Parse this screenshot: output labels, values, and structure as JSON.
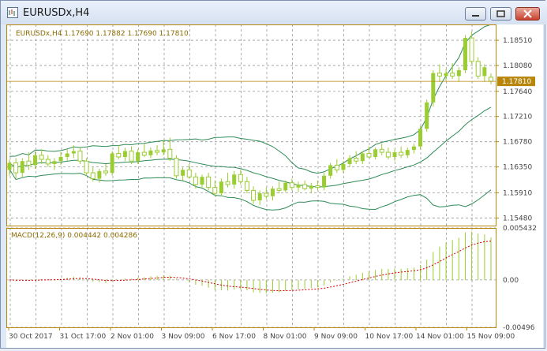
{
  "window": {
    "title": "EURUSDx,H4"
  },
  "colors": {
    "background": "#ffffff",
    "frame": "#b8860b",
    "grid": "#9a9a9a",
    "candle_bull": "#9acd32",
    "candle_bear": "#9acd32",
    "bands": "#2e8b57",
    "macd_hist": "#9acd32",
    "macd_signal": "#cc0000",
    "price_tag_bg": "#b8860b",
    "axis_text": "#b8860b"
  },
  "chart_data": [
    {
      "type": "candlestick",
      "symbol": "EURUSDx",
      "timeframe": "H4",
      "legend": "EURUSDx,H4  1.17690 1.17882 1.17690 1.17810",
      "ohlc_label": {
        "open": 1.1769,
        "high": 1.17882,
        "low": 1.1769,
        "close": 1.1781
      },
      "current_price": "1.17810",
      "y_ticks": [
        "1.18510",
        "1.18080",
        "1.17640",
        "1.17210",
        "1.16780",
        "1.16350",
        "1.15910",
        "1.15480"
      ],
      "ylim": [
        1.1535,
        1.1878
      ],
      "candles": [
        [
          1.163,
          1.1648,
          1.162,
          1.1642
        ],
        [
          1.1642,
          1.165,
          1.1615,
          1.1625
        ],
        [
          1.1625,
          1.165,
          1.1618,
          1.1645
        ],
        [
          1.1645,
          1.166,
          1.163,
          1.1638
        ],
        [
          1.1638,
          1.1662,
          1.1632,
          1.1655
        ],
        [
          1.1655,
          1.1665,
          1.164,
          1.1648
        ],
        [
          1.1648,
          1.1655,
          1.1635,
          1.164
        ],
        [
          1.164,
          1.165,
          1.163,
          1.1645
        ],
        [
          1.1645,
          1.166,
          1.1638,
          1.1652
        ],
        [
          1.1652,
          1.1665,
          1.1645,
          1.1658
        ],
        [
          1.1658,
          1.1672,
          1.165,
          1.1662
        ],
        [
          1.1662,
          1.1668,
          1.164,
          1.1645
        ],
        [
          1.1645,
          1.165,
          1.162,
          1.1625
        ],
        [
          1.1625,
          1.1635,
          1.161,
          1.1615
        ],
        [
          1.1615,
          1.1632,
          1.1608,
          1.1628
        ],
        [
          1.1628,
          1.164,
          1.162,
          1.1625
        ],
        [
          1.1625,
          1.1662,
          1.162,
          1.1658
        ],
        [
          1.1658,
          1.1672,
          1.1648,
          1.1652
        ],
        [
          1.1652,
          1.1668,
          1.1645,
          1.1662
        ],
        [
          1.1662,
          1.167,
          1.164,
          1.1645
        ],
        [
          1.1645,
          1.1665,
          1.164,
          1.166
        ],
        [
          1.166,
          1.1675,
          1.1652,
          1.1655
        ],
        [
          1.1655,
          1.1668,
          1.165,
          1.1663
        ],
        [
          1.1663,
          1.1672,
          1.1655,
          1.166
        ],
        [
          1.166,
          1.168,
          1.1655,
          1.1665
        ],
        [
          1.1665,
          1.1685,
          1.1645,
          1.165
        ],
        [
          1.165,
          1.1655,
          1.1615,
          1.162
        ],
        [
          1.162,
          1.1635,
          1.1612,
          1.163
        ],
        [
          1.163,
          1.164,
          1.1615,
          1.1618
        ],
        [
          1.1618,
          1.1625,
          1.1598,
          1.1605
        ],
        [
          1.1605,
          1.1622,
          1.16,
          1.1618
        ],
        [
          1.1618,
          1.1625,
          1.1595,
          1.16
        ],
        [
          1.16,
          1.1612,
          1.1585,
          1.159
        ],
        [
          1.159,
          1.1615,
          1.1585,
          1.161
        ],
        [
          1.161,
          1.1625,
          1.16,
          1.1605
        ],
        [
          1.1605,
          1.1628,
          1.1598,
          1.1622
        ],
        [
          1.1622,
          1.163,
          1.1605,
          1.161
        ],
        [
          1.161,
          1.1618,
          1.159,
          1.1595
        ],
        [
          1.1595,
          1.1602,
          1.1572,
          1.1578
        ],
        [
          1.1578,
          1.1595,
          1.157,
          1.159
        ],
        [
          1.159,
          1.16,
          1.158,
          1.1585
        ],
        [
          1.1585,
          1.1602,
          1.1578,
          1.1598
        ],
        [
          1.1598,
          1.161,
          1.159,
          1.1595
        ],
        [
          1.1595,
          1.1612,
          1.1592,
          1.1608
        ],
        [
          1.1608,
          1.1615,
          1.1595,
          1.16
        ],
        [
          1.16,
          1.161,
          1.1592,
          1.1605
        ],
        [
          1.1605,
          1.1612,
          1.1595,
          1.1598
        ],
        [
          1.1598,
          1.1608,
          1.159,
          1.1603
        ],
        [
          1.1603,
          1.1612,
          1.1595,
          1.16
        ],
        [
          1.16,
          1.1625,
          1.1595,
          1.162
        ],
        [
          1.162,
          1.1642,
          1.1615,
          1.1638
        ],
        [
          1.1638,
          1.1648,
          1.1625,
          1.163
        ],
        [
          1.163,
          1.1645,
          1.1625,
          1.164
        ],
        [
          1.164,
          1.1655,
          1.1635,
          1.165
        ],
        [
          1.165,
          1.1662,
          1.164,
          1.1645
        ],
        [
          1.1645,
          1.1662,
          1.164,
          1.1658
        ],
        [
          1.1658,
          1.167,
          1.165,
          1.1652
        ],
        [
          1.1652,
          1.1668,
          1.1648,
          1.1665
        ],
        [
          1.1665,
          1.1675,
          1.1655,
          1.166
        ],
        [
          1.166,
          1.1668,
          1.1648,
          1.1652
        ],
        [
          1.1652,
          1.1665,
          1.1645,
          1.166
        ],
        [
          1.166,
          1.167,
          1.165,
          1.1655
        ],
        [
          1.1655,
          1.1668,
          1.165,
          1.1664
        ],
        [
          1.1664,
          1.1675,
          1.1658,
          1.167
        ],
        [
          1.167,
          1.1705,
          1.1665,
          1.17
        ],
        [
          1.17,
          1.175,
          1.1695,
          1.1745
        ],
        [
          1.1745,
          1.18,
          1.1738,
          1.1795
        ],
        [
          1.1795,
          1.181,
          1.178,
          1.179
        ],
        [
          1.179,
          1.1802,
          1.1782,
          1.1795
        ],
        [
          1.1795,
          1.1812,
          1.1785,
          1.179
        ],
        [
          1.179,
          1.1805,
          1.178,
          1.18
        ],
        [
          1.18,
          1.186,
          1.1795,
          1.1855
        ],
        [
          1.1855,
          1.1866,
          1.181,
          1.1815
        ],
        [
          1.1815,
          1.1822,
          1.1785,
          1.179
        ],
        [
          1.179,
          1.181,
          1.178,
          1.1805
        ],
        [
          1.1788,
          1.1795,
          1.1776,
          1.1781
        ]
      ]
    },
    {
      "type": "bar",
      "indicator": "MACD",
      "legend": "MACD(12,26,9) 0.004442 0.004286",
      "params": [
        12,
        26,
        9
      ],
      "macd_value": 0.004442,
      "signal_value": 0.004286,
      "y_ticks": [
        "0.005432",
        "0.00",
        "-0.00496"
      ],
      "ylim": [
        -0.00496,
        0.005432
      ]
    }
  ],
  "x_labels": [
    "30 Oct 2017",
    "31 Oct 17:00",
    "2 Nov 01:00",
    "3 Nov 09:00",
    "6 Nov 17:00",
    "8 Nov 01:00",
    "9 Nov 09:00",
    "10 Nov 17:00",
    "14 Nov 01:00",
    "15 Nov 09:00"
  ]
}
